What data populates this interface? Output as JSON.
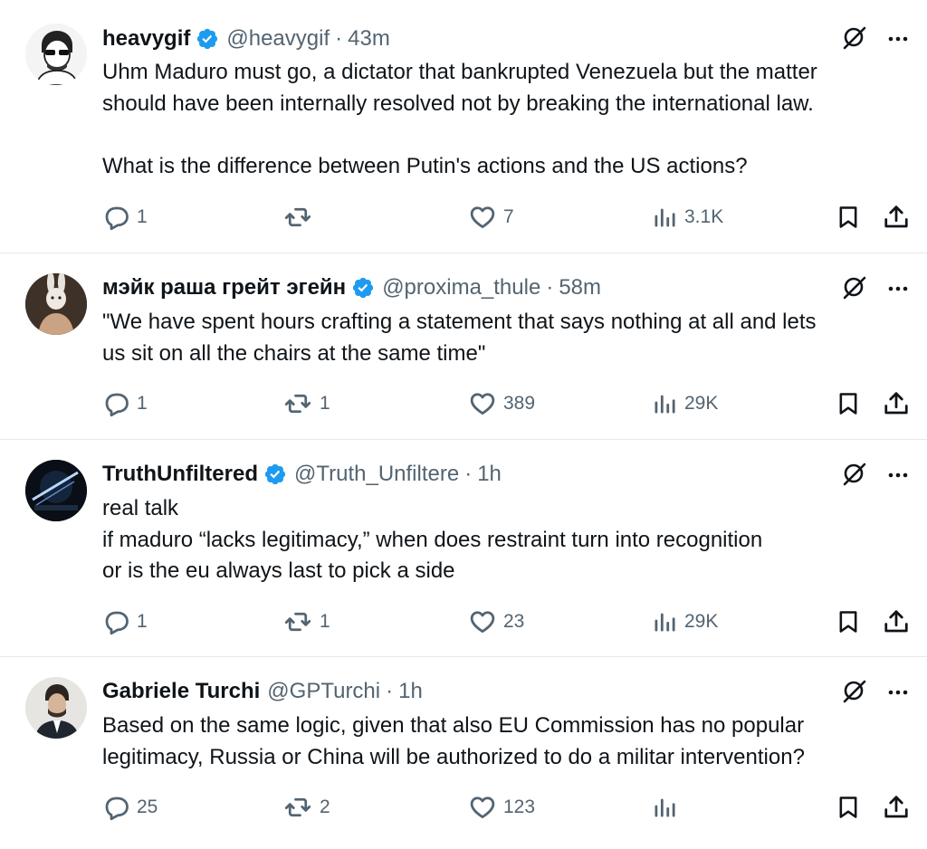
{
  "tweets": [
    {
      "name": "heavygif",
      "handle": "@heavygif",
      "time": "43m",
      "lines": [
        "Uhm Maduro must go, a dictator that bankrupted Venezuela but the matter",
        "should have been internally resolved not by breaking the international law.",
        "",
        "What is the difference between Putin's actions and the US actions?"
      ],
      "replies": "1",
      "retweets": "",
      "likes": "7",
      "views": "3.1K"
    },
    {
      "name": "мэйк раша грейт эгейн",
      "handle": "@proxima_thule",
      "time": "58m",
      "lines": [
        "\"We have spent hours crafting a statement that says nothing at all and lets",
        "us sit on all the chairs at the same time\""
      ],
      "replies": "1",
      "retweets": "1",
      "likes": "389",
      "views": "29K"
    },
    {
      "name": "TruthUnfiltered",
      "handle": "@Truth_Unfiltere",
      "time": "1h",
      "lines": [
        "real talk",
        "if maduro “lacks legitimacy,” when does restraint turn into recognition",
        "or is the eu always last to pick a side"
      ],
      "replies": "1",
      "retweets": "1",
      "likes": "23",
      "views": "29K"
    },
    {
      "name": "Gabriele Turchi",
      "handle": "@GPTurchi",
      "time": "1h",
      "lines": [
        "Based on the same logic, given that also EU Commission has no popular",
        "legitimacy, Russia or China will be authorized to do a militar intervention?"
      ],
      "replies": "25",
      "retweets": "2",
      "likes": "123",
      "views": ""
    }
  ],
  "separator": "·",
  "icons": {
    "verified": "verified-badge-icon",
    "grok": "grok-icon",
    "more": "more-icon",
    "reply": "reply-icon",
    "retweet": "retweet-icon",
    "like": "like-icon",
    "views": "views-icon",
    "bookmark": "bookmark-icon",
    "share": "share-icon"
  },
  "colors": {
    "verified": "#1d9bf0",
    "secondary": "#536471",
    "text": "#0f1419"
  }
}
